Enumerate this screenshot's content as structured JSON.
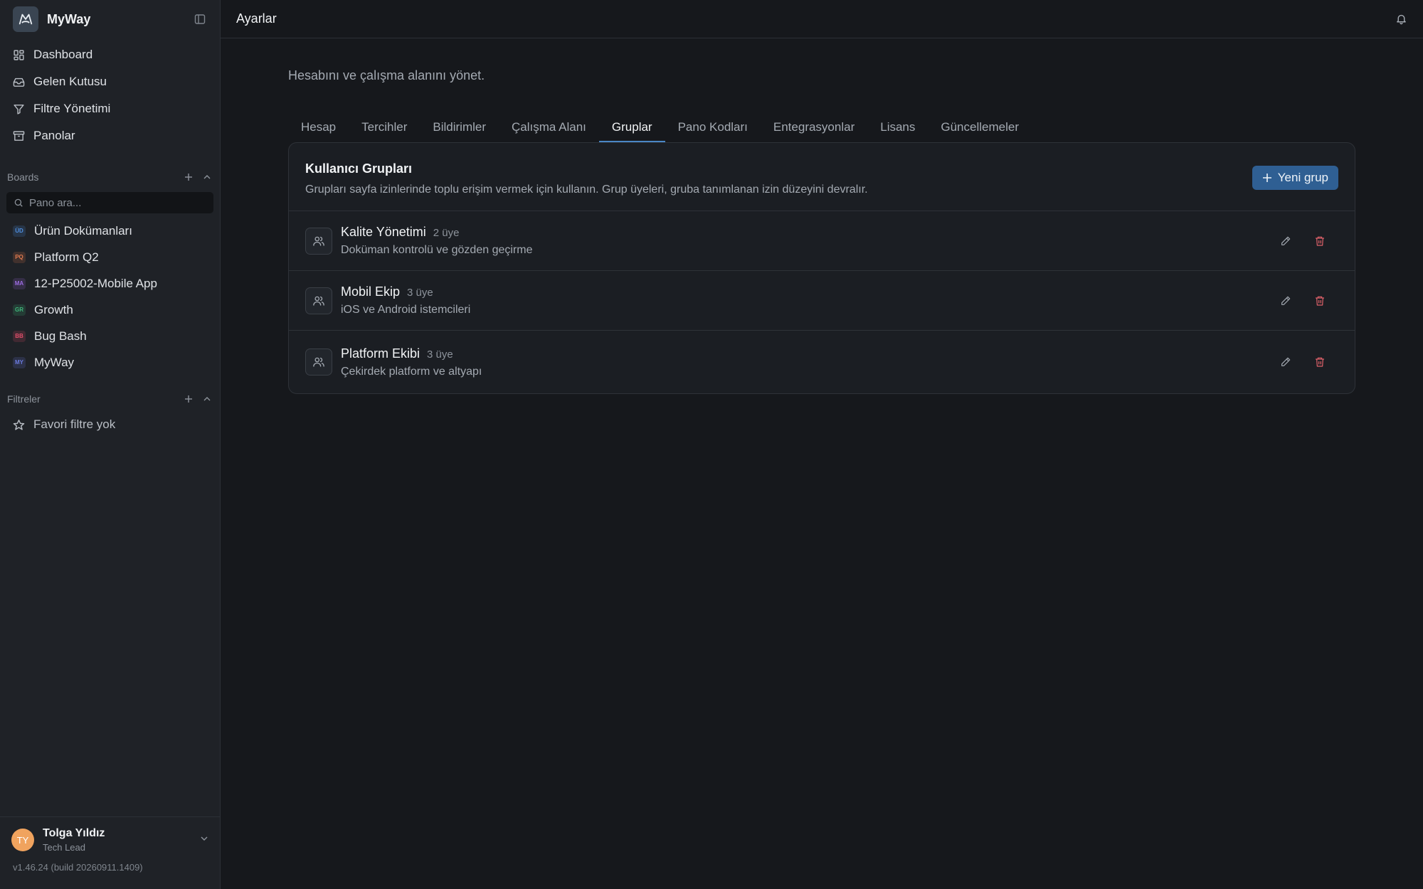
{
  "app": {
    "name": "MyWay"
  },
  "sidebar": {
    "nav": [
      {
        "label": "Dashboard",
        "icon": "grid-icon"
      },
      {
        "label": "Gelen Kutusu",
        "icon": "inbox-icon"
      },
      {
        "label": "Filtre Yönetimi",
        "icon": "filter-icon"
      },
      {
        "label": "Panolar",
        "icon": "archive-icon"
      }
    ],
    "boards": {
      "title": "Boards",
      "search_placeholder": "Pano ara...",
      "items": [
        {
          "badge": "ÜD",
          "label": "Ürün Dokümanları",
          "color": "#4f8fe0"
        },
        {
          "badge": "PQ",
          "label": "Platform Q2",
          "color": "#e07a4f"
        },
        {
          "badge": "MA",
          "label": "12-P25002-Mobile App",
          "color": "#9b6be0"
        },
        {
          "badge": "GR",
          "label": "Growth",
          "color": "#3fb57a"
        },
        {
          "badge": "BB",
          "label": "Bug Bash",
          "color": "#e04f6a"
        },
        {
          "badge": "MY",
          "label": "MyWay",
          "color": "#6b7be0"
        }
      ]
    },
    "filters": {
      "title": "Filtreler",
      "empty_label": "Favori filtre yok"
    },
    "user": {
      "initials": "TY",
      "name": "Tolga Yıldız",
      "role": "Tech Lead"
    },
    "version": "v1.46.24 (build 20260911.1409)"
  },
  "header": {
    "title": "Ayarlar"
  },
  "settings": {
    "subtitle": "Hesabını ve çalışma alanını yönet.",
    "tabs": [
      {
        "label": "Hesap",
        "active": false
      },
      {
        "label": "Tercihler",
        "active": false
      },
      {
        "label": "Bildirimler",
        "active": false
      },
      {
        "label": "Çalışma Alanı",
        "active": false
      },
      {
        "label": "Gruplar",
        "active": true
      },
      {
        "label": "Pano Kodları",
        "active": false
      },
      {
        "label": "Entegrasyonlar",
        "active": false
      },
      {
        "label": "Lisans",
        "active": false
      },
      {
        "label": "Güncellemeler",
        "active": false
      }
    ],
    "groups_card": {
      "title": "Kullanıcı Grupları",
      "description": "Grupları sayfa izinlerinde toplu erişim vermek için kullanın. Grup üyeleri, gruba tanımlanan izin düzeyini devralır.",
      "new_button": "Yeni grup",
      "groups": [
        {
          "name": "Kalite Yönetimi",
          "count": "2 üye",
          "description": "Doküman kontrolü ve gözden geçirme"
        },
        {
          "name": "Mobil Ekip",
          "count": "3 üye",
          "description": "iOS ve Android istemcileri"
        },
        {
          "name": "Platform Ekibi",
          "count": "3 üye",
          "description": "Çekirdek platform ve altyapı"
        }
      ]
    }
  },
  "colors": {
    "accent": "#4a86c5",
    "primary_button": "#2f5f93",
    "danger": "#e0626a",
    "avatar": "#f0a35e"
  }
}
